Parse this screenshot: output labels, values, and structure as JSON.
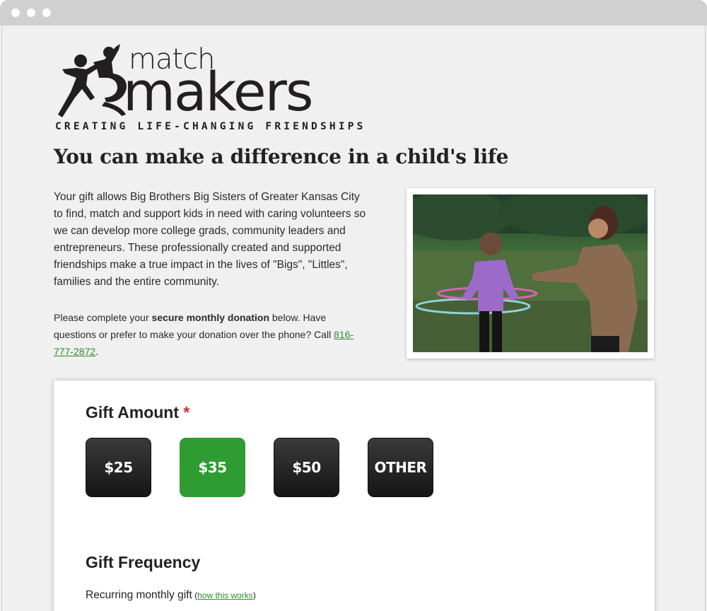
{
  "window": {
    "controls": [
      "window-dot",
      "window-dot",
      "window-dot"
    ]
  },
  "logo": {
    "word_top": "match",
    "word_bottom": "makers",
    "tagline": "CREATING LIFE-CHANGING FRIENDSHIPS"
  },
  "headline": "You can make a difference in a child's life",
  "intro": "Your gift allows Big Brothers Big Sisters of Greater Kansas City to find, match and support kids in need with caring volunteers so we can develop more college grads, community leaders and entrepreneurs. These professionally created and supported friendships make a true impact in the lives of \"Bigs\", \"Littles\", families and the entire community.",
  "note": {
    "prefix": "Please complete your ",
    "bold": "secure monthly donation",
    "middle": " below. Have questions or prefer to make your donation over the phone? Call ",
    "phone_line1": "816-",
    "phone_line2": "777-2872",
    "suffix": "."
  },
  "gift_amount": {
    "title": "Gift Amount",
    "required_mark": "*",
    "options": [
      "$25",
      "$35",
      "$50",
      "OTHER"
    ],
    "selected": "$35"
  },
  "gift_frequency": {
    "title": "Gift Frequency",
    "recurring_label": "Recurring monthly gift",
    "help_open": " (",
    "help_link": "how this works",
    "help_close": ")"
  },
  "colors": {
    "accent_green": "#2f9b33",
    "button_dark": "#222222",
    "required_red": "#d8302b",
    "link_green": "#2e8b2e"
  }
}
